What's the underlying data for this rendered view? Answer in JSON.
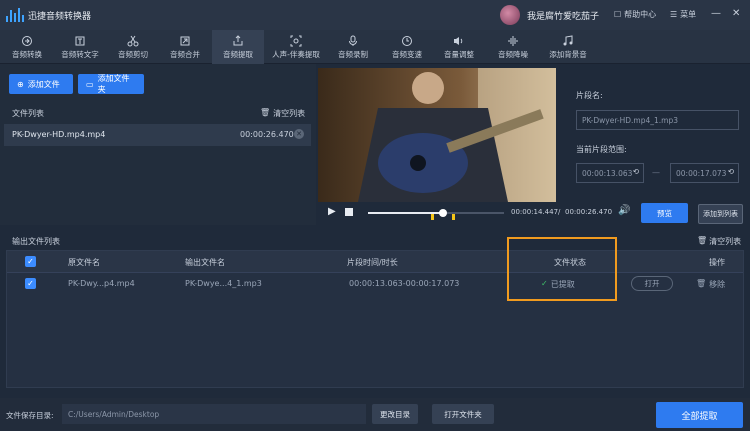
{
  "app": {
    "title": "迅捷音频转换器"
  },
  "user": {
    "name": "我是腐竹爱吃茄子"
  },
  "titlebar": {
    "help_label": "帮助中心",
    "menu_label": "菜单"
  },
  "toolbar": {
    "tabs": [
      {
        "label": "音频转换",
        "icon": "convert-icon"
      },
      {
        "label": "音频转文字",
        "icon": "text-icon"
      },
      {
        "label": "音频剪切",
        "icon": "scissors-icon"
      },
      {
        "label": "音频合并",
        "icon": "merge-icon"
      },
      {
        "label": "音频提取",
        "icon": "extract-icon"
      },
      {
        "label": "人声-伴奏提取",
        "icon": "vocal-icon"
      },
      {
        "label": "音频录制",
        "icon": "mic-icon"
      },
      {
        "label": "音频变速",
        "icon": "speed-icon"
      },
      {
        "label": "音量调整",
        "icon": "volume-icon"
      },
      {
        "label": "音频降噪",
        "icon": "denoise-icon"
      },
      {
        "label": "添加背景音",
        "icon": "bgm-icon"
      }
    ],
    "active": "音频提取"
  },
  "left": {
    "add_file": "添加文件",
    "add_folder": "添加文件夹",
    "list_title": "文件列表",
    "clear_list": "清空列表",
    "file": {
      "name": "PK-Dwyer-HD.mp4.mp4",
      "duration": "00:00:26.470"
    }
  },
  "player": {
    "current_time": "00:00:14.447",
    "separator": "/",
    "total_time": "00:00:26.470",
    "progress": 0.55,
    "preview_label": "预览",
    "add_to_list_label": "添加到列表"
  },
  "segment": {
    "name_label": "片段名:",
    "name_value": "PK-Dwyer-HD.mp4_1.mp3",
    "range_label": "当前片段范围:",
    "start": "00:00:13.063",
    "dash": "—",
    "end": "00:00:17.073"
  },
  "output": {
    "title": "输出文件列表",
    "clear_list": "清空列表",
    "headers": {
      "source": "原文件名",
      "output": "输出文件名",
      "segment": "片段时间/时长",
      "status": "文件状态",
      "action": "操作"
    },
    "rows": [
      {
        "source": "PK-Dwy...p4.mp4",
        "output": "PK-Dwye...4_1.mp3",
        "segment": "00:00:13.063-00:00:17.073",
        "status": "已提取",
        "open": "打开",
        "remove": "移除"
      }
    ]
  },
  "bottom": {
    "save_dir_label": "文件保存目录:",
    "save_dir_value": "C:/Users/Admin/Desktop",
    "change_dir": "更改目录",
    "open_folder": "打开文件夹",
    "extract_all": "全部提取"
  },
  "colors": {
    "accent": "#2e7bf0",
    "highlight": "#f19b1f",
    "success": "#3fbf6a"
  }
}
